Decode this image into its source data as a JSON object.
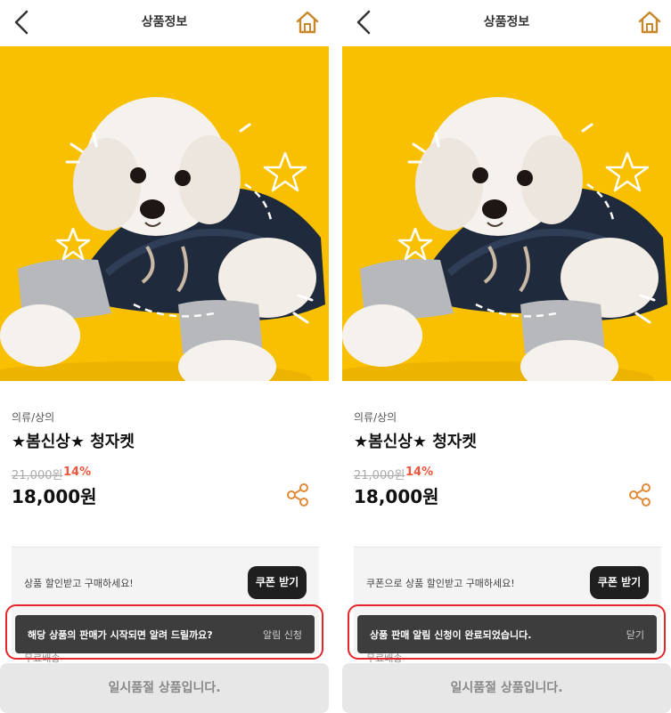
{
  "screens": [
    {
      "header": {
        "title": "상품정보"
      },
      "product": {
        "category": "의류/상의",
        "name": "★봄신상★ 청자켓",
        "original_price": "21,000원",
        "discount": "14%",
        "price": "18,000원"
      },
      "coupon": {
        "text": "상품 할인받고 구매하세요!",
        "button": "쿠폰 받기",
        "below_text": "무료배송"
      },
      "toast": {
        "message": "해당 상품의 판매가 시작되면 알려 드릴까요?",
        "action": "알림 신청"
      },
      "bottom_bar": {
        "label": "일시품절 상품입니다."
      }
    },
    {
      "header": {
        "title": "상품정보"
      },
      "product": {
        "category": "의류/상의",
        "name": "★봄신상★ 청자켓",
        "original_price": "21,000원",
        "discount": "14%",
        "price": "18,000원"
      },
      "coupon": {
        "text": "쿠폰으로 상품 할인받고 구매하세요!",
        "button": "쿠폰 받기",
        "below_text": "무료배송"
      },
      "toast": {
        "message": "상품 판매 알림 신청이 완료되었습니다.",
        "action": "닫기"
      },
      "bottom_bar": {
        "label": "일시품절 상품입니다."
      }
    }
  ],
  "icons": {
    "back": "back-arrow-icon",
    "home": "home-icon",
    "share": "share-icon"
  },
  "colors": {
    "photo_background": "#f8c000",
    "discount": "#f0553c",
    "coupon_button": "#1f1f1f",
    "toast_background": "#3d3d3d",
    "highlight_border": "#e4252c",
    "soldout_background": "#e7e7e7",
    "home_icon": "#c8872a"
  }
}
